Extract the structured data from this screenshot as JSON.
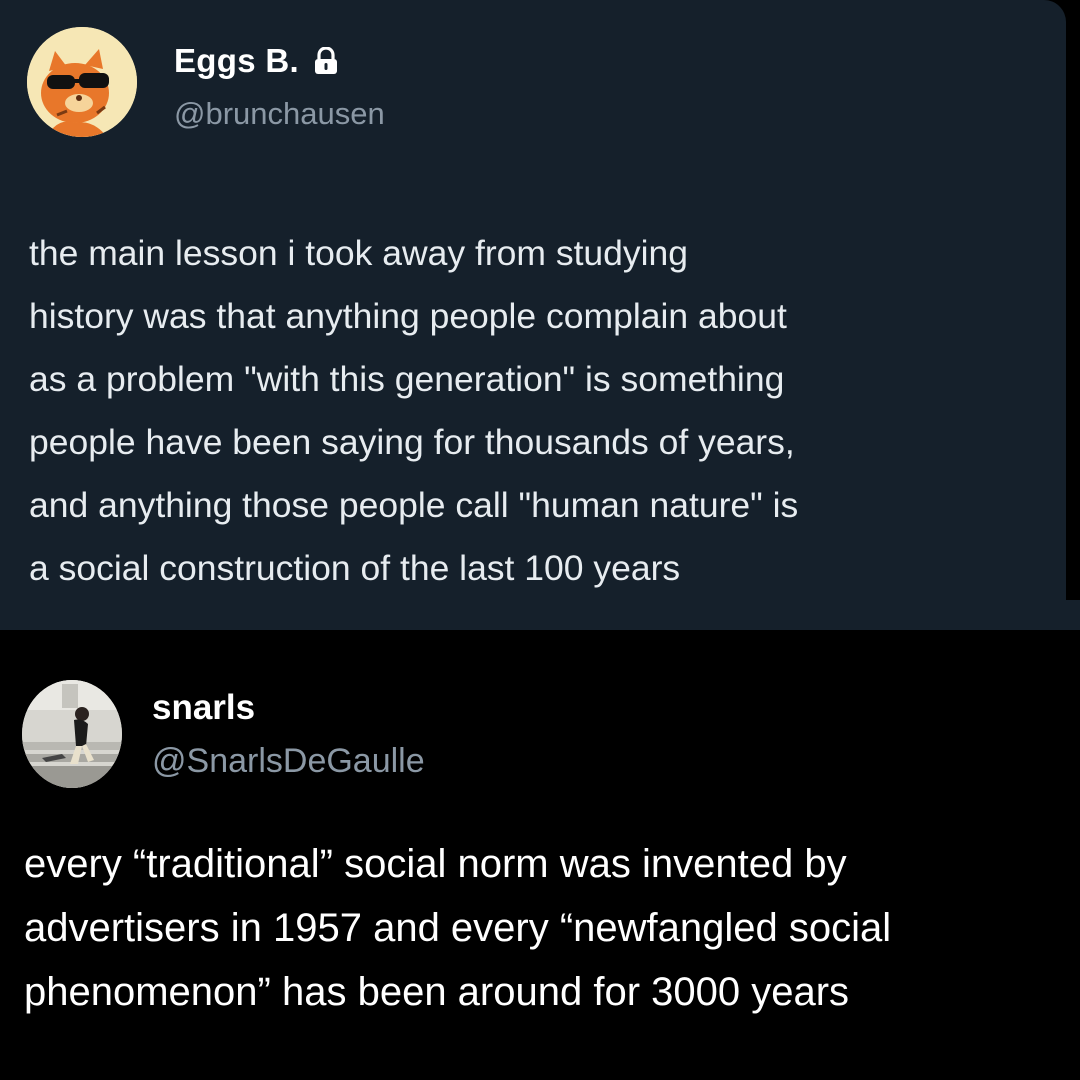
{
  "tweets": [
    {
      "avatar_icon": "cartoon-cat-avatar",
      "display_name": "Eggs B.",
      "lock_icon": "lock-icon",
      "handle": "@brunchausen",
      "lines": [
        "the main lesson i took away from studying",
        "history was that anything people complain about",
        "as a problem \"with this generation\" is something",
        "people have been saying for thousands of years,",
        "and anything those people call \"human nature\" is",
        "a social construction of the last 100 years"
      ],
      "background": "#15202b"
    },
    {
      "avatar_icon": "photo-avatar",
      "display_name": "snarls",
      "handle": "@SnarlsDeGaulle",
      "lines": [
        "every “traditional” social norm was invented by",
        "advertisers in 1957 and every “newfangled social",
        "phenomenon” has been around for 3000 years"
      ],
      "background": "#000000"
    }
  ],
  "colors": {
    "text_primary": "#ffffff",
    "text_secondary": "#8b98a5"
  }
}
